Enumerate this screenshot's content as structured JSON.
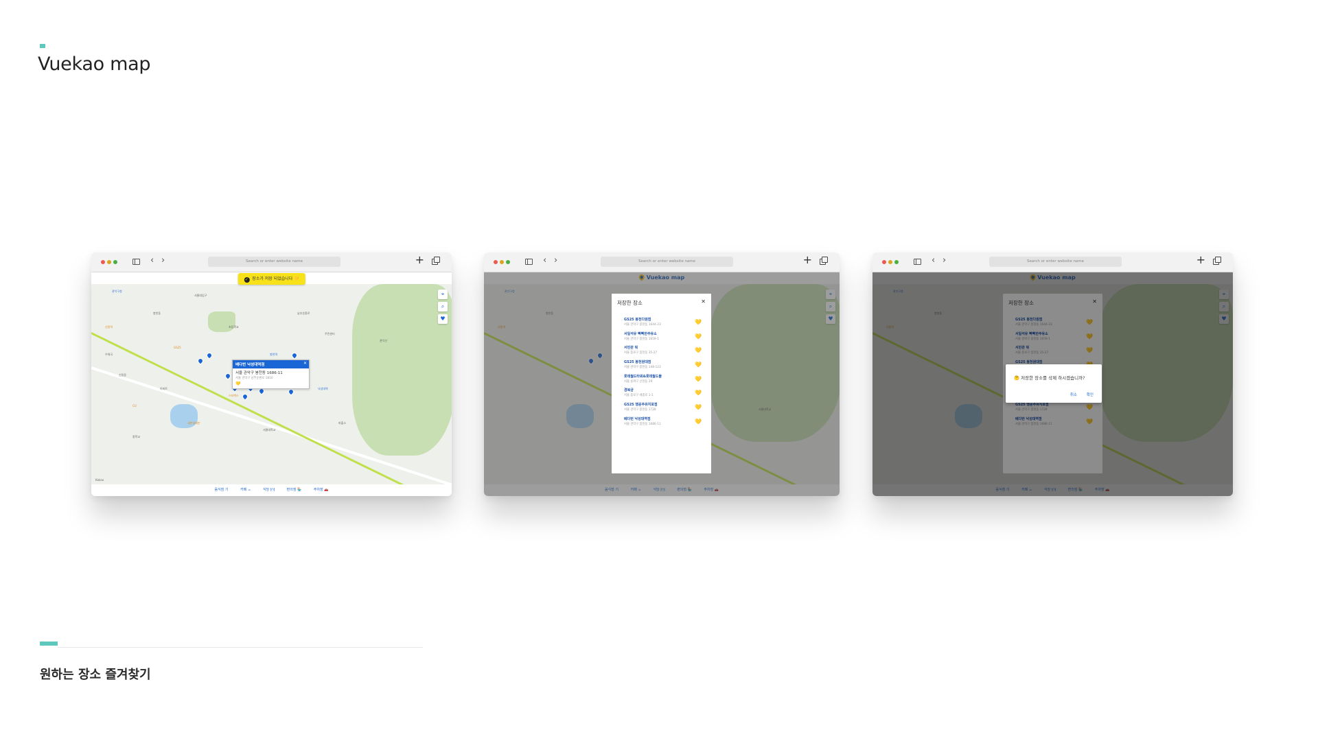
{
  "page": {
    "title": "Vuekao map",
    "caption": "원하는 장소 즐겨찾기"
  },
  "browser": {
    "address_placeholder": "Search or enter website name",
    "back_glyph": "‹",
    "forward_glyph": "›",
    "new_tab_glyph": "+"
  },
  "app": {
    "brand": "Vuekao map",
    "toast": "장소가 저장 되었습니다 💛",
    "bottom_nav": [
      "음식점 기",
      "카페 ☕",
      "식당 🍽",
      "편의점 🏪",
      "주차장 🚗"
    ],
    "map_labels": [
      "관악구청",
      "서울대입구",
      "봉천역",
      "신림역",
      "낙성대역",
      "봉천동",
      "신림동",
      "서울대학교",
      "관악산",
      "남부순환로",
      "GS25",
      "CU",
      "스타벅스",
      "세븐일레븐",
      "주민센터",
      "우체국",
      "파출소",
      "아파트",
      "초등학교",
      "중학교"
    ],
    "scale_label": "Kakao"
  },
  "infowindow": {
    "title": "베다번 낙성대역점",
    "address": "서울 관악구 봉천동 1686-11",
    "sub": "서울 관악구 남부순환로 1810",
    "heart": "💛",
    "close": "✕"
  },
  "saved_panel": {
    "title": "저장한 장소",
    "close": "✕",
    "items": [
      {
        "name": "GS25 봉천다원점",
        "address": "서울 관악구 봉천동 1644-23",
        "heart": "💛"
      },
      {
        "name": "서일석유 빡빡한주유소",
        "address": "서울 관악구 봉천동 1659-1",
        "heart": "💛"
      },
      {
        "name": "서민관 뭐",
        "address": "서울 종로구 봉천동 35-27",
        "heart": "💛"
      },
      {
        "name": "GS25 봉천원대점",
        "address": "서울 관악구 봉천동 148-123",
        "heart": "💛"
      },
      {
        "name": "롯데월드타워&롯데월드몰",
        "address": "서울 송파구 신천동 29",
        "heart": "💛"
      },
      {
        "name": "경복궁",
        "address": "서울 종로구 세종로 1-1",
        "heart": "💛"
      },
      {
        "name": "GS25 행운주유지포점",
        "address": "서울 관악구 봉천동 1728",
        "heart": "💛"
      },
      {
        "name": "베다번 낙성대역점",
        "address": "서울 관악구 봉천동 1686-11",
        "heart": "💛"
      }
    ]
  },
  "confirm_dialog": {
    "message": "🤔 저장한 장소를 삭제 하시겠습니까?",
    "cancel": "취소",
    "ok": "확인"
  },
  "colors": {
    "accent": "#5fc8bd",
    "brand_blue": "#1a66d6",
    "heart_yellow": "#f2c200",
    "toast_yellow": "#f7e21a",
    "subway_line": "#bfe04a"
  }
}
